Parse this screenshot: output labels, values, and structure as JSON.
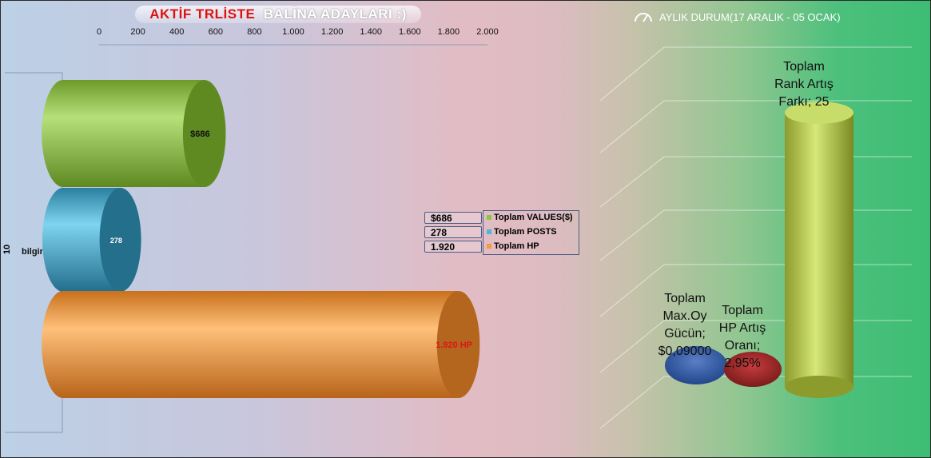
{
  "title": {
    "part1": "AKTİF TRLİSTE",
    "part2": "BALİNA ADAYLARI :)"
  },
  "right_title": "AYLIK DURUM(17 ARALIK - 05 OCAK)",
  "icons": {
    "speedometer": "speedometer-icon"
  },
  "colors": {
    "green": "#8cc63f",
    "blue": "#4bb6d8",
    "orange": "#f59a3e",
    "red": "#d81818"
  },
  "chart_data": [
    {
      "type": "bar",
      "orientation": "horizontal",
      "xlim": [
        0,
        2000
      ],
      "xticks": [
        "0",
        "200",
        "400",
        "600",
        "800",
        "1.000",
        "1.200",
        "1.400",
        "1.600",
        "1.800",
        "2.000"
      ],
      "category_outer": "10",
      "category_inner": "bilgin70",
      "series": [
        {
          "name": "Toplam VALUES($)",
          "value": 686,
          "label": "$686",
          "legend_value": "$686",
          "color": "#8cc63f"
        },
        {
          "name": "Toplam POSTS",
          "value": 278,
          "label": "278",
          "legend_value": "278",
          "color": "#4bb6d8"
        },
        {
          "name": "Toplam HP",
          "value": 1920,
          "label": "1.920 HP",
          "legend_value": "1.920",
          "color": "#f59a3e"
        }
      ]
    },
    {
      "type": "bar",
      "subtype": "3d-cylinder",
      "series": [
        {
          "label_lines": [
            "Toplam",
            "Max.Oy",
            "Gücün;",
            "$0,09000"
          ],
          "value": 0.09
        },
        {
          "label_lines": [
            "Toplam",
            "HP Artış",
            "Oranı;",
            "2,95%"
          ],
          "value": 2.95
        },
        {
          "label_lines": [
            "Toplam",
            "Rank Artış",
            "Farkı; 25"
          ],
          "value": 25
        }
      ]
    }
  ]
}
